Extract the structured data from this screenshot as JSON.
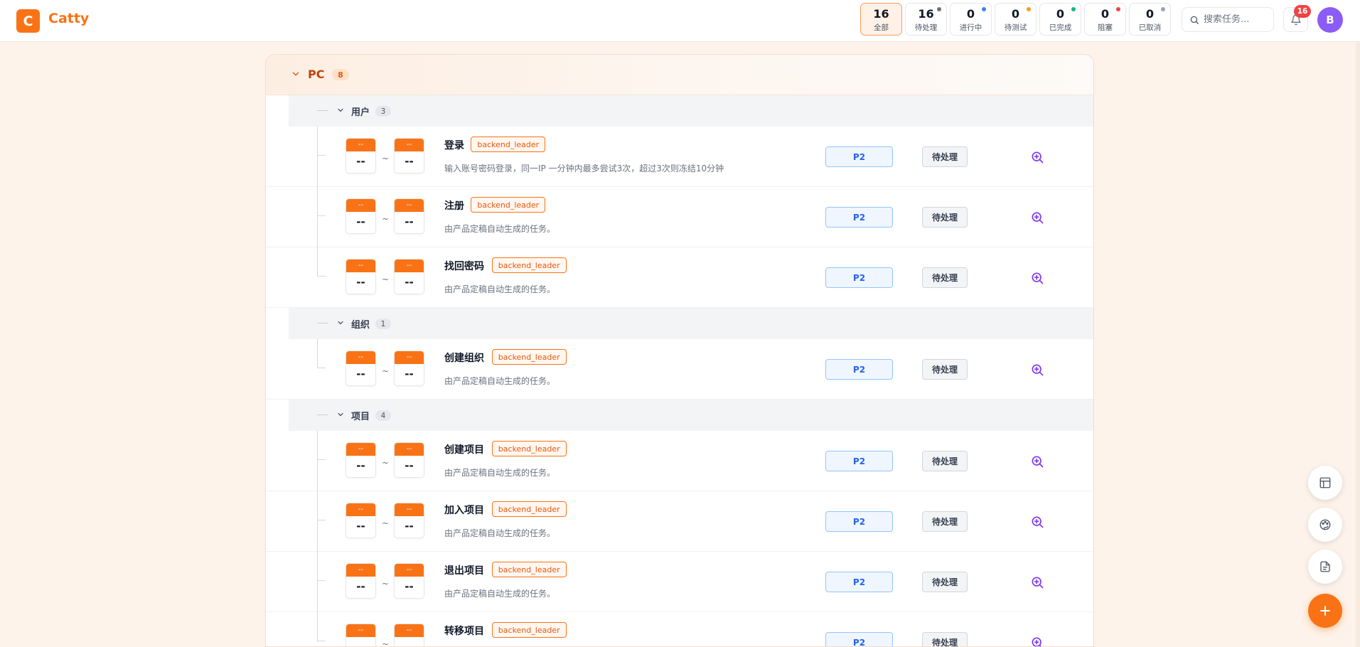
{
  "app": {
    "logo_letter": "C",
    "name": "Catty"
  },
  "stats": [
    {
      "count": "16",
      "label": "全部",
      "active": true,
      "dot": ""
    },
    {
      "count": "16",
      "label": "待处理",
      "active": false,
      "dot": "#6b7280"
    },
    {
      "count": "0",
      "label": "进行中",
      "active": false,
      "dot": "#3b82f6"
    },
    {
      "count": "0",
      "label": "待测试",
      "active": false,
      "dot": "#f59e0b"
    },
    {
      "count": "0",
      "label": "已完成",
      "active": false,
      "dot": "#10b981"
    },
    {
      "count": "0",
      "label": "阻塞",
      "active": false,
      "dot": "#ef4444"
    },
    {
      "count": "0",
      "label": "已取消",
      "active": false,
      "dot": "#9ca3af"
    }
  ],
  "search": {
    "placeholder": "搜索任务..."
  },
  "notifications": {
    "count": "16"
  },
  "user": {
    "initial": "B"
  },
  "group": {
    "title": "PC",
    "count": "8"
  },
  "calendar": {
    "top": "--",
    "bottom": "--",
    "separator": "~"
  },
  "subgroups": [
    {
      "title": "用户",
      "count": "3",
      "tasks": [
        {
          "title": "登录",
          "tag": "backend_leader",
          "desc": "输入账号密码登录，同一IP 一分钟内最多尝试3次，超过3次则冻结10分钟",
          "priority": "P2",
          "status": "待处理"
        },
        {
          "title": "注册",
          "tag": "backend_leader",
          "desc": "由产品定稿自动生成的任务。",
          "priority": "P2",
          "status": "待处理"
        },
        {
          "title": "找回密码",
          "tag": "backend_leader",
          "desc": "由产品定稿自动生成的任务。",
          "priority": "P2",
          "status": "待处理"
        }
      ]
    },
    {
      "title": "组织",
      "count": "1",
      "tasks": [
        {
          "title": "创建组织",
          "tag": "backend_leader",
          "desc": "由产品定稿自动生成的任务。",
          "priority": "P2",
          "status": "待处理"
        }
      ]
    },
    {
      "title": "项目",
      "count": "4",
      "tasks": [
        {
          "title": "创建项目",
          "tag": "backend_leader",
          "desc": "由产品定稿自动生成的任务。",
          "priority": "P2",
          "status": "待处理"
        },
        {
          "title": "加入项目",
          "tag": "backend_leader",
          "desc": "由产品定稿自动生成的任务。",
          "priority": "P2",
          "status": "待处理"
        },
        {
          "title": "退出项目",
          "tag": "backend_leader",
          "desc": "由产品定稿自动生成的任务。",
          "priority": "P2",
          "status": "待处理"
        },
        {
          "title": "转移项目",
          "tag": "backend_leader",
          "desc": "",
          "priority": "P2",
          "status": "待处理"
        }
      ]
    }
  ],
  "fabs": [
    "layout-icon",
    "palette-icon",
    "document-icon",
    "plus-icon"
  ],
  "colors": {
    "accent": "#f97316",
    "priority": "#2563eb",
    "avatar": "#8b5cf6",
    "badge": "#ef4444"
  }
}
